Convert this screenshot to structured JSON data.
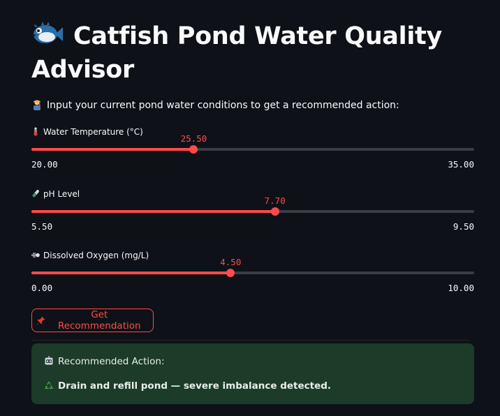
{
  "title": "Catfish Pond Water Quality Advisor",
  "title_icon": "blowfish-icon",
  "intro": "Input your current pond water conditions to get a recommended action:",
  "intro_icon": "farmer-icon",
  "sliders": [
    {
      "label": "Water Temperature (°C)",
      "icon": "thermometer-icon",
      "min": 20.0,
      "max": 35.0,
      "value": 25.5,
      "min_text": "20.00",
      "max_text": "35.00",
      "value_text": "25.50"
    },
    {
      "label": "pH Level",
      "icon": "test-tube-icon",
      "min": 5.5,
      "max": 9.5,
      "value": 7.7,
      "min_text": "5.50",
      "max_text": "9.50",
      "value_text": "7.70"
    },
    {
      "label": "Dissolved Oxygen (mg/L)",
      "icon": "dash-wind-icon",
      "min": 0.0,
      "max": 10.0,
      "value": 4.5,
      "min_text": "0.00",
      "max_text": "10.00",
      "value_text": "4.50"
    }
  ],
  "button": {
    "label": "Get Recommendation",
    "icon": "pushpin-icon"
  },
  "result": {
    "heading": "Recommended Action:",
    "heading_icon": "robot-icon",
    "action": "Drain and refill pond — severe imbalance detected.",
    "action_icon": "recycle-icon"
  },
  "colors": {
    "background": "#0e1117",
    "accent": "#ff4b4b",
    "track": "#3b3d45",
    "success_bg": "#1c3b29"
  }
}
